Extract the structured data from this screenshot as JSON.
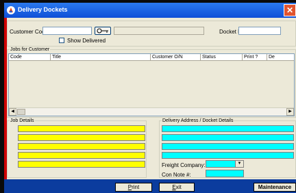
{
  "window": {
    "title": "Delivery Dockets",
    "close_glyph": "✕"
  },
  "header": {
    "customer_code_label": "Customer Code:",
    "customer_code_value": "",
    "customer_name_value": "",
    "docket_no_label": "Docket No:",
    "docket_no_value": "",
    "show_delivered_label": "Show Delivered"
  },
  "jobs": {
    "group_label": "Jobs for Customer",
    "columns": [
      "Code",
      "Title",
      "Customer O/N",
      "Status",
      "Print ?",
      "De"
    ]
  },
  "job_details": {
    "group_label": "Job Details"
  },
  "delivery": {
    "group_label": "Delivery Address / Docket Details",
    "freight_company_label": "Freight Company:",
    "con_note_label": "Con Note #:"
  },
  "buttons": {
    "print": "Print",
    "exit": "Exit",
    "maintenance": "Maintenance"
  },
  "colors": {
    "title_bar": "#1a60e0",
    "window_border": "#cf0000",
    "yellow_field": "#ffff00",
    "cyan_field": "#00ffff"
  }
}
